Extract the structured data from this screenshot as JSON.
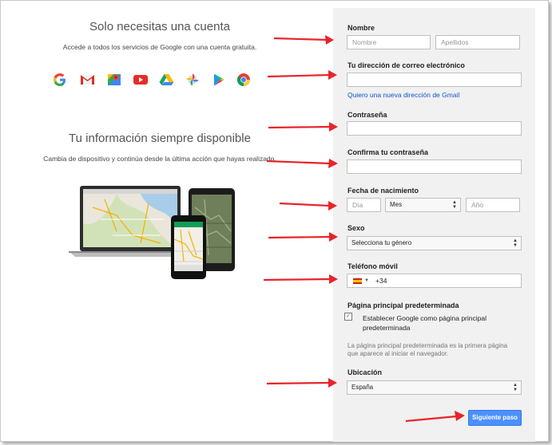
{
  "left": {
    "heading1": "Solo necesitas una cuenta",
    "subtext1": "Accede a todos los servicios de Google con una cuenta gratuita.",
    "heading2": "Tu información siempre disponible",
    "subtext2": "Cambia de dispositivo y continúa desde la última acción que hayas realizado.",
    "service_icons": [
      "google-g-icon",
      "gmail-icon",
      "maps-icon",
      "youtube-icon",
      "drive-icon",
      "photos-icon",
      "play-store-icon",
      "chrome-icon"
    ]
  },
  "form": {
    "name_label": "Nombre",
    "first_name_placeholder": "Nombre",
    "last_name_placeholder": "Apellidos",
    "email_label": "Tu dirección de correo electrónico",
    "email_link": "Quiero una nueva dirección de Gmail",
    "password_label": "Contraseña",
    "confirm_label": "Confirma tu contraseña",
    "birth_label": "Fecha de nacimiento",
    "day_placeholder": "Día",
    "month_value": "Mes",
    "year_placeholder": "Año",
    "gender_label": "Sexo",
    "gender_value": "Selecciona tu género",
    "phone_label": "Teléfono móvil",
    "phone_prefix": "+34",
    "homepage_label": "Página principal predeterminada",
    "homepage_checkbox": "Establecer Google como página principal predeterminada",
    "homepage_note": "La página principal predeterminada es la primera página que aparece al iniciar el navegador.",
    "location_label": "Ubicación",
    "location_value": "España",
    "next_button": "Siguiente paso"
  },
  "colors": {
    "arrow": "#e8242a",
    "button": "#4d90fe",
    "link": "#1155cc",
    "panel": "#f1f1f1"
  }
}
